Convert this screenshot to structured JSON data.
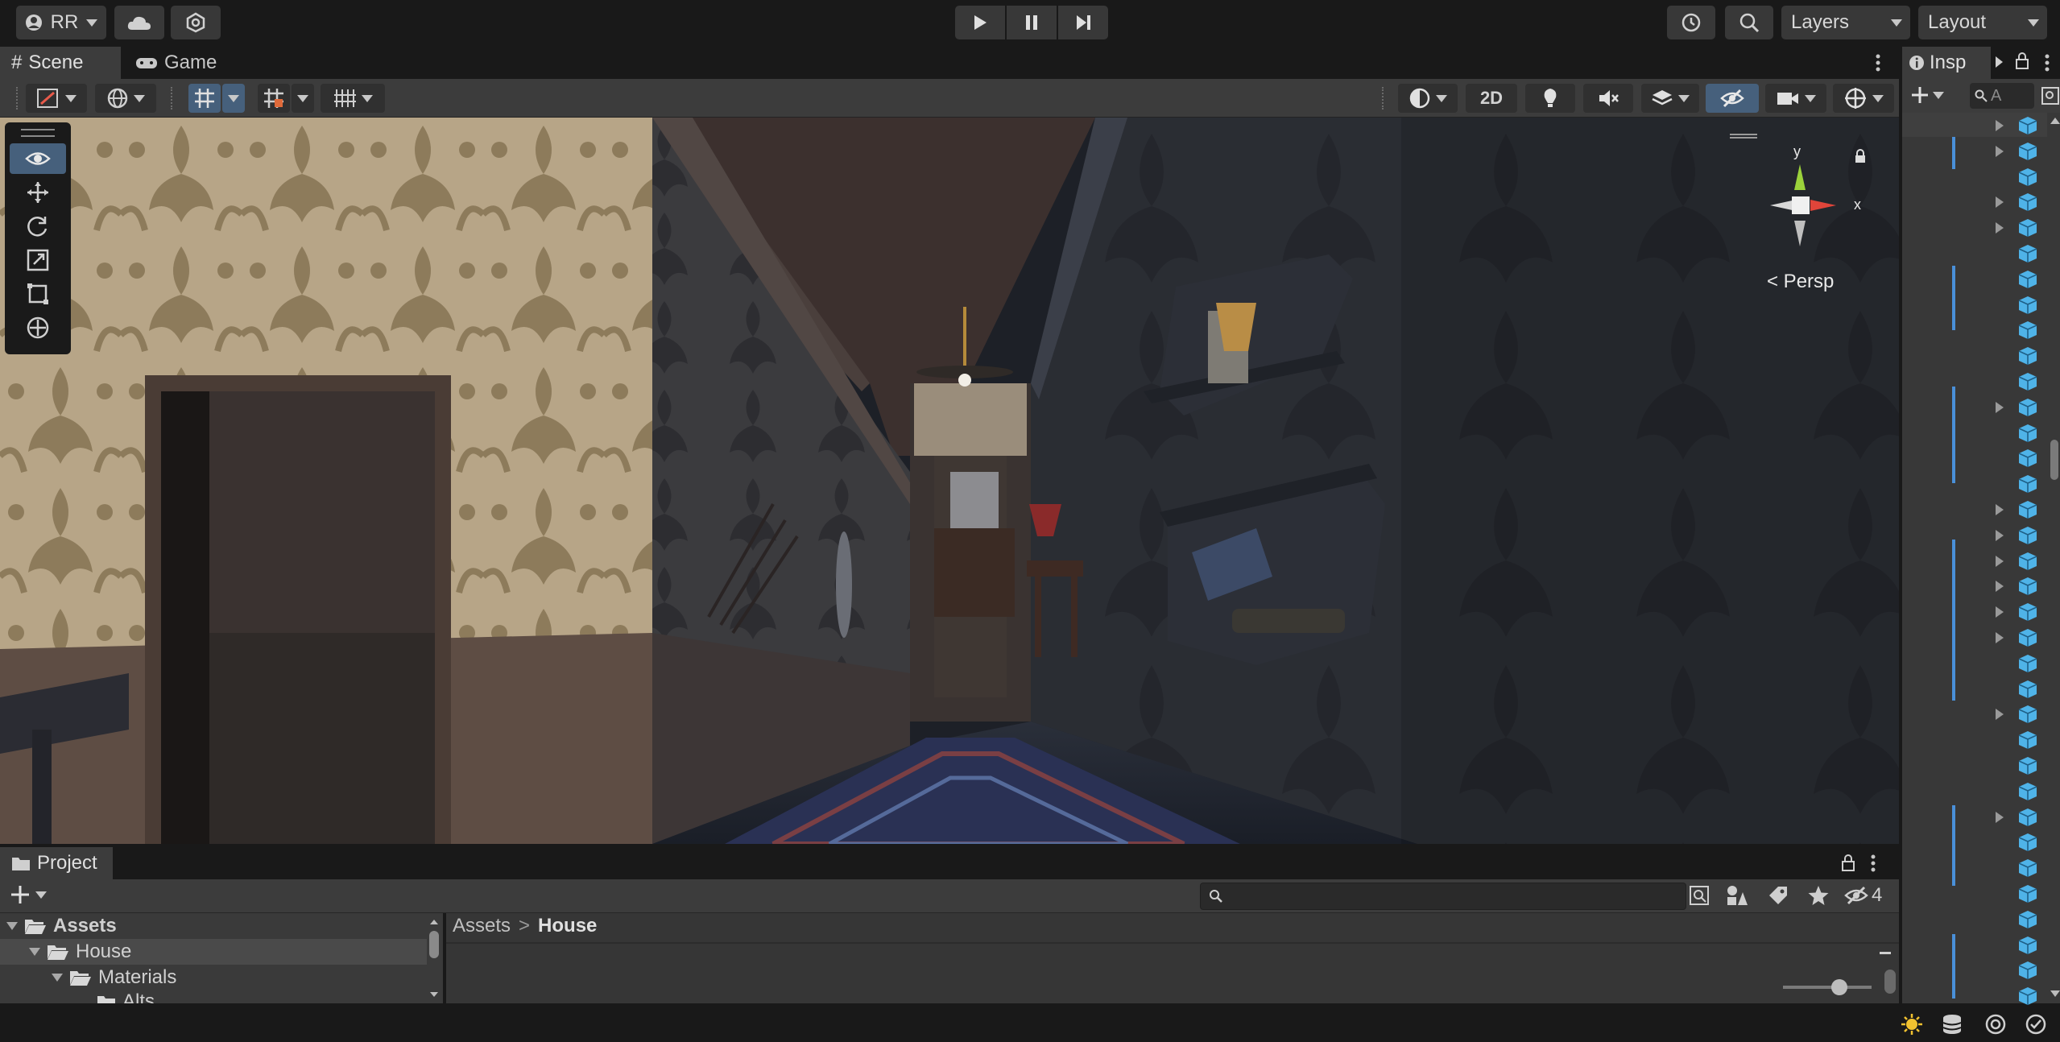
{
  "topbar": {
    "account_label": "RR",
    "layers_label": "Layers",
    "layout_label": "Layout"
  },
  "scene_tabs": {
    "scene": "Scene",
    "game": "Game"
  },
  "scene_toolbar": {
    "mode_2d": "2D"
  },
  "gizmo": {
    "y_label": "y",
    "x_label": "x",
    "persp_label": "< Persp"
  },
  "project": {
    "tab_label": "Project",
    "hidden_count": "4",
    "breadcrumb": [
      "Assets",
      "House"
    ],
    "tree": [
      {
        "label": "Assets",
        "depth": 0,
        "bold": true
      },
      {
        "label": "House",
        "depth": 1,
        "bold": false
      },
      {
        "label": "Materials",
        "depth": 2,
        "bold": false
      },
      {
        "label": "Alts",
        "depth": 3,
        "bold": false
      }
    ]
  },
  "right_panel": {
    "tab_label": "Insp",
    "search_placeholder": "A"
  },
  "colors": {
    "accent_blue": "#46607c",
    "cube_blue": "#4fb3e8",
    "panel_dark": "#191919",
    "panel_mid": "#3c3c3c"
  }
}
